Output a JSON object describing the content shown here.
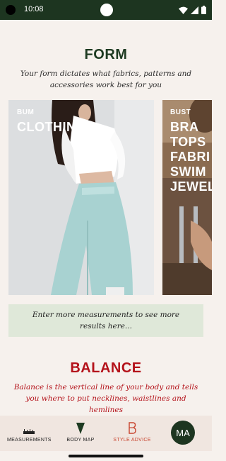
{
  "status_bar": {
    "time": "10:08",
    "icons": [
      "wifi-icon",
      "signal-icon",
      "battery-icon"
    ]
  },
  "form_section": {
    "title": "FORM",
    "subtitle": "Your form dictates what fabrics, patterns and accessories work best for you",
    "cards": [
      {
        "label": "BUM",
        "items": [
          "CLOTHING"
        ],
        "image": "woman-wide-leg-trousers-photo"
      },
      {
        "label": "BUST",
        "items": [
          "BRA",
          "TOPS",
          "FABRI",
          "SWIM",
          "JEWEL"
        ],
        "image": "woman-poolside-photo"
      }
    ],
    "more_message": "Enter more measurements to see more results here..."
  },
  "balance_section": {
    "title": "BALANCE",
    "subtitle": "Balance is the vertical line of your body and tells you where to put necklines, waistlines and hemlines"
  },
  "bottom_nav": {
    "items": [
      {
        "label": "MEASUREMENTS",
        "icon": "ruler-icon",
        "active": false
      },
      {
        "label": "BODY MAP",
        "icon": "body-map-icon",
        "active": false
      },
      {
        "label": "STYLE ADVICE",
        "icon": "style-advice-icon",
        "active": true
      }
    ],
    "avatar_initials": "MA"
  },
  "colors": {
    "brand_green": "#1d3520",
    "accent_red": "#b4121a",
    "active_orange": "#c8442e",
    "background": "#f6f1ed",
    "info_box": "#dfe8d9"
  }
}
